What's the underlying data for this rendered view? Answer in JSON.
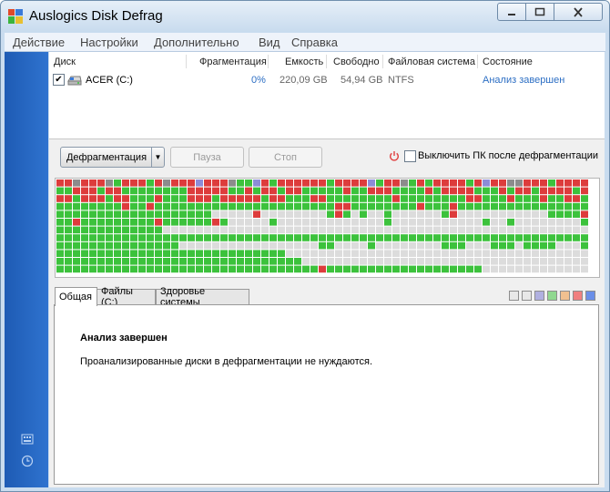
{
  "window": {
    "title": "Auslogics Disk Defrag"
  },
  "menu": [
    "Действие",
    "Настройки",
    "Дополнительно",
    "Вид",
    "Справка"
  ],
  "table": {
    "columns": [
      "Диск",
      "Фрагментация",
      "Емкость",
      "Свободно",
      "Файловая система",
      "Состояние"
    ],
    "rows": [
      {
        "checked": true,
        "disk": "ACER (C:)",
        "fragmentation": "0%",
        "capacity": "220,09 GB",
        "free": "54,94 GB",
        "fs": "NTFS",
        "status": "Анализ завершен"
      }
    ]
  },
  "toolbar": {
    "defrag_label": "Дефрагментация",
    "pause_label": "Пауза",
    "stop_label": "Стоп",
    "shutdown_label": "Выключить ПК после дефрагментации",
    "shutdown_checked": false
  },
  "tabs": [
    "Общая",
    "Файлы (C:)",
    "Здоровье системы"
  ],
  "legend_colors": [
    "#e8e8e8",
    "#e8e8e8",
    "#b0b0e0",
    "#90d890",
    "#f0c090",
    "#f08080",
    "#6b8fe8"
  ],
  "status": {
    "title": "Анализ завершен",
    "message": "Проанализированные диски в дефрагментации не нуждаются."
  },
  "cluster_map": {
    "colors": {
      "free": "#dcdcdc",
      "contiguous": "#3cc23c",
      "fragmented": "#dd3c3c",
      "system": "#8c8c8c",
      "mft": "#8c8cd8"
    }
  }
}
